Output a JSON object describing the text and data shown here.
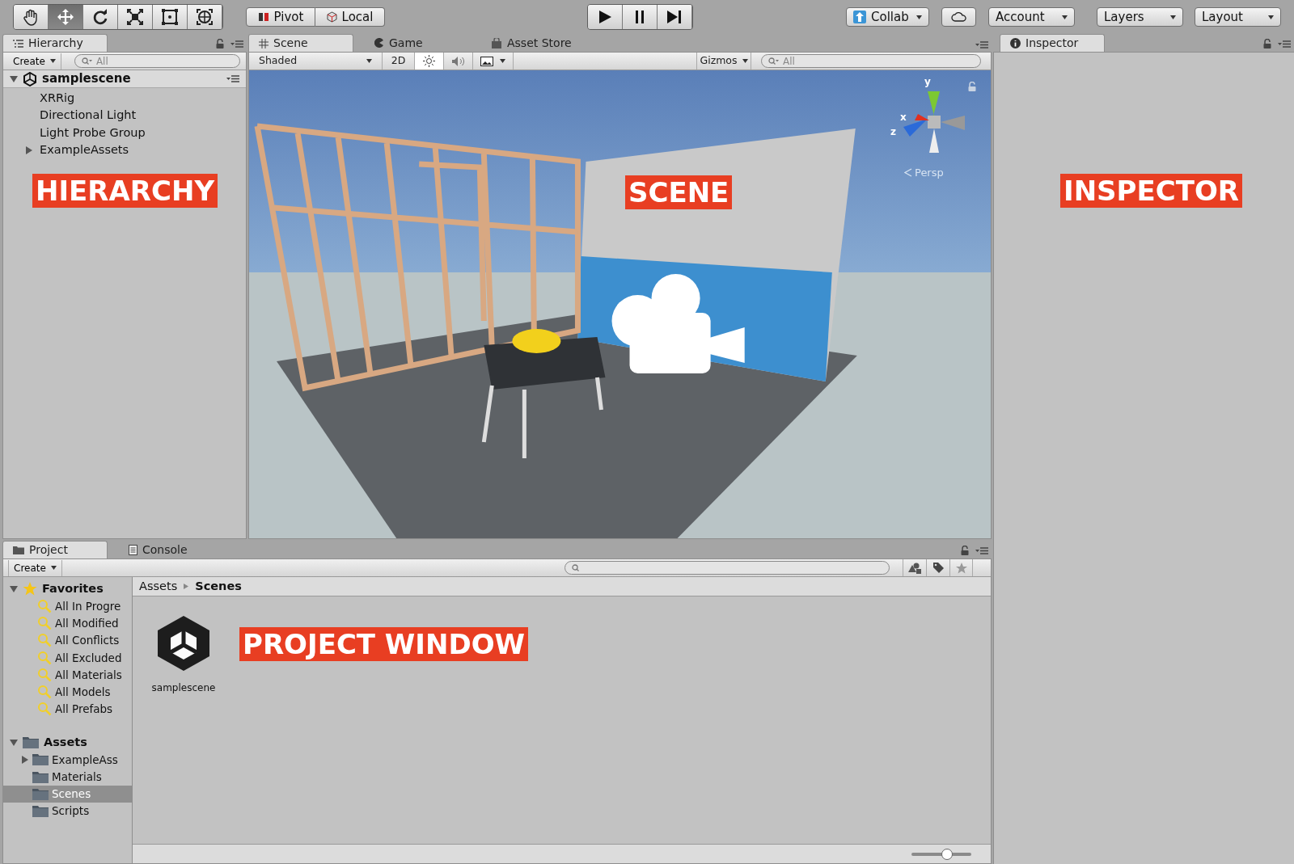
{
  "toolbar": {
    "transform_tools": [
      {
        "kind": "hand",
        "selected": false
      },
      {
        "kind": "move",
        "selected": true
      },
      {
        "kind": "rotate",
        "selected": false
      },
      {
        "kind": "scale",
        "selected": false
      },
      {
        "kind": "rect",
        "selected": false
      },
      {
        "kind": "transform",
        "selected": false
      }
    ],
    "pivot": "Pivot",
    "local": "Local",
    "play_controls": [
      {
        "kind": "play"
      },
      {
        "kind": "pause"
      },
      {
        "kind": "step"
      }
    ],
    "collab": "Collab",
    "account": "Account",
    "layers": "Layers",
    "layout": "Layout"
  },
  "hierarchy": {
    "tab": "Hierarchy",
    "create": "Create",
    "search_placeholder": "All",
    "scene": "samplescene",
    "items": [
      {
        "label": "XRRig",
        "kind": "leaf"
      },
      {
        "label": "Directional Light",
        "kind": "leaf"
      },
      {
        "label": "Light Probe Group",
        "kind": "leaf"
      },
      {
        "label": "ExampleAssets",
        "kind": "group",
        "expanded": false
      }
    ],
    "annotation": "HIERARCHY"
  },
  "scene_view": {
    "tabs": [
      {
        "label": "Scene",
        "kind": "scene",
        "selected": true
      },
      {
        "label": "Game",
        "kind": "game",
        "selected": false
      },
      {
        "label": "Asset Store",
        "kind": "store",
        "selected": false
      }
    ],
    "shading": "Shaded",
    "mode_2d": "2D",
    "lighting_on": true,
    "gizmos": "Gizmos",
    "search_placeholder": "All",
    "axes": {
      "y": "y",
      "x": "x",
      "z": "z"
    },
    "projection": "Persp",
    "annotation": "SCENE"
  },
  "inspector": {
    "tab": "Inspector",
    "annotation": "INSPECTOR"
  },
  "project": {
    "tabs": [
      {
        "label": "Project",
        "kind": "project",
        "selected": true
      },
      {
        "label": "Console",
        "kind": "console",
        "selected": false
      }
    ],
    "create": "Create",
    "favorites": {
      "label": "Favorites",
      "expanded": true,
      "items": [
        "All In Progre",
        "All Modified",
        "All Conflicts",
        "All Excluded",
        "All Materials",
        "All Models",
        "All Prefabs"
      ]
    },
    "assets": {
      "label": "Assets",
      "expanded": true,
      "children": [
        {
          "label": "ExampleAss",
          "kind": "group",
          "expanded": false,
          "selected": false
        },
        {
          "label": "Materials",
          "kind": "leaf",
          "selected": false
        },
        {
          "label": "Scenes",
          "kind": "leaf",
          "selected": true
        },
        {
          "label": "Scripts",
          "kind": "leaf",
          "selected": false
        }
      ]
    },
    "breadcrumb": [
      "Assets",
      "Scenes"
    ],
    "files": [
      {
        "label": "samplescene"
      }
    ],
    "annotation": "PROJECT WINDOW",
    "zoom": {
      "level": 0.6
    }
  }
}
